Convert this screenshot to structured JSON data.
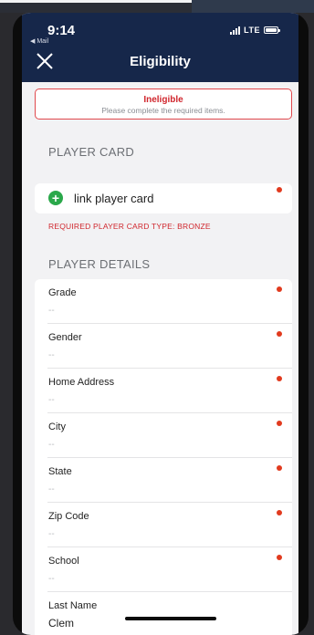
{
  "status_bar": {
    "time": "9:14",
    "back_app": "◀ Mail",
    "network": "LTE"
  },
  "nav": {
    "title": "Eligibility"
  },
  "banner": {
    "title": "Ineligible",
    "subtitle": "Please complete the required items."
  },
  "player_card": {
    "header": "PLAYER CARD",
    "link_label": "link player card",
    "required_note": "REQUIRED PLAYER CARD TYPE: BRONZE"
  },
  "player_details": {
    "header": "PLAYER DETAILS",
    "fields": [
      {
        "label": "Grade",
        "value": "--",
        "required": true
      },
      {
        "label": "Gender",
        "value": "--",
        "required": true
      },
      {
        "label": "Home Address",
        "value": "--",
        "required": true
      },
      {
        "label": "City",
        "value": "--",
        "required": true
      },
      {
        "label": "State",
        "value": "--",
        "required": true
      },
      {
        "label": "Zip Code",
        "value": "--",
        "required": true
      },
      {
        "label": "School",
        "value": "--",
        "required": true
      },
      {
        "label": "Last Name",
        "value": "Clem",
        "required": false
      }
    ]
  },
  "colors": {
    "nav_background": "#16274a",
    "error_red": "#d0262d",
    "required_dot": "#e13a1e",
    "add_green": "#2aa84a"
  }
}
